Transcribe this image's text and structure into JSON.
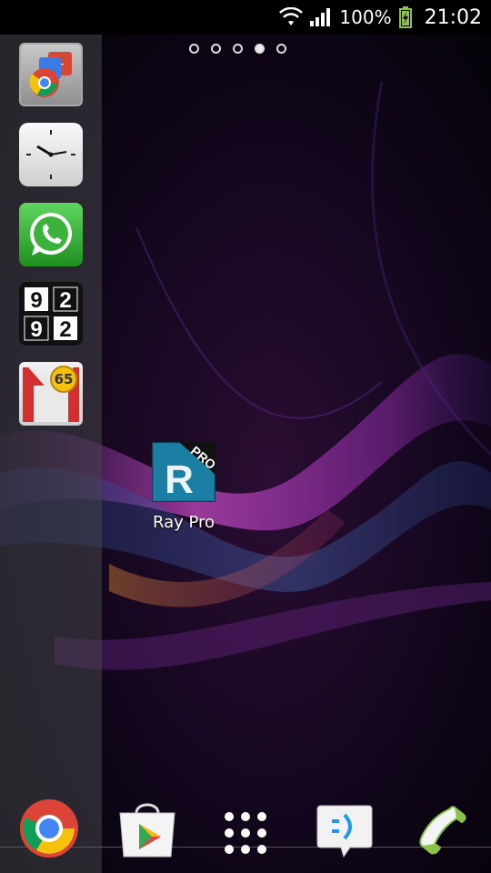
{
  "status_bar": {
    "battery_percent": "100%",
    "time": "21:02",
    "icons": [
      "wifi-icon",
      "signal-icon",
      "battery-charging-icon"
    ]
  },
  "home": {
    "page_count": 5,
    "active_page": 4
  },
  "side_panel": {
    "items": [
      {
        "name": "google-apps-folder-icon"
      },
      {
        "name": "clock-icon"
      },
      {
        "name": "whatsapp-icon"
      },
      {
        "name": "flip-clock-widget-icon",
        "digits_top": "92",
        "digits_bottom": "92"
      },
      {
        "name": "gmail-icon",
        "badge": "65"
      }
    ]
  },
  "desktop_apps": [
    {
      "name": "ray-pro",
      "label": "Ray Pro",
      "icon_letter": "R",
      "ribbon": "PRO"
    }
  ],
  "dock": {
    "items": [
      "chrome-icon",
      "play-store-icon",
      "app-drawer-icon",
      "messaging-icon",
      "phone-icon"
    ]
  },
  "colors": {
    "status_bar": "#000000",
    "ray_pro_bg": "#1c6f8f",
    "gmail_red": "#d32f2f",
    "badge_yellow": "#f4c20d",
    "whatsapp_green": "#3bb33b"
  }
}
